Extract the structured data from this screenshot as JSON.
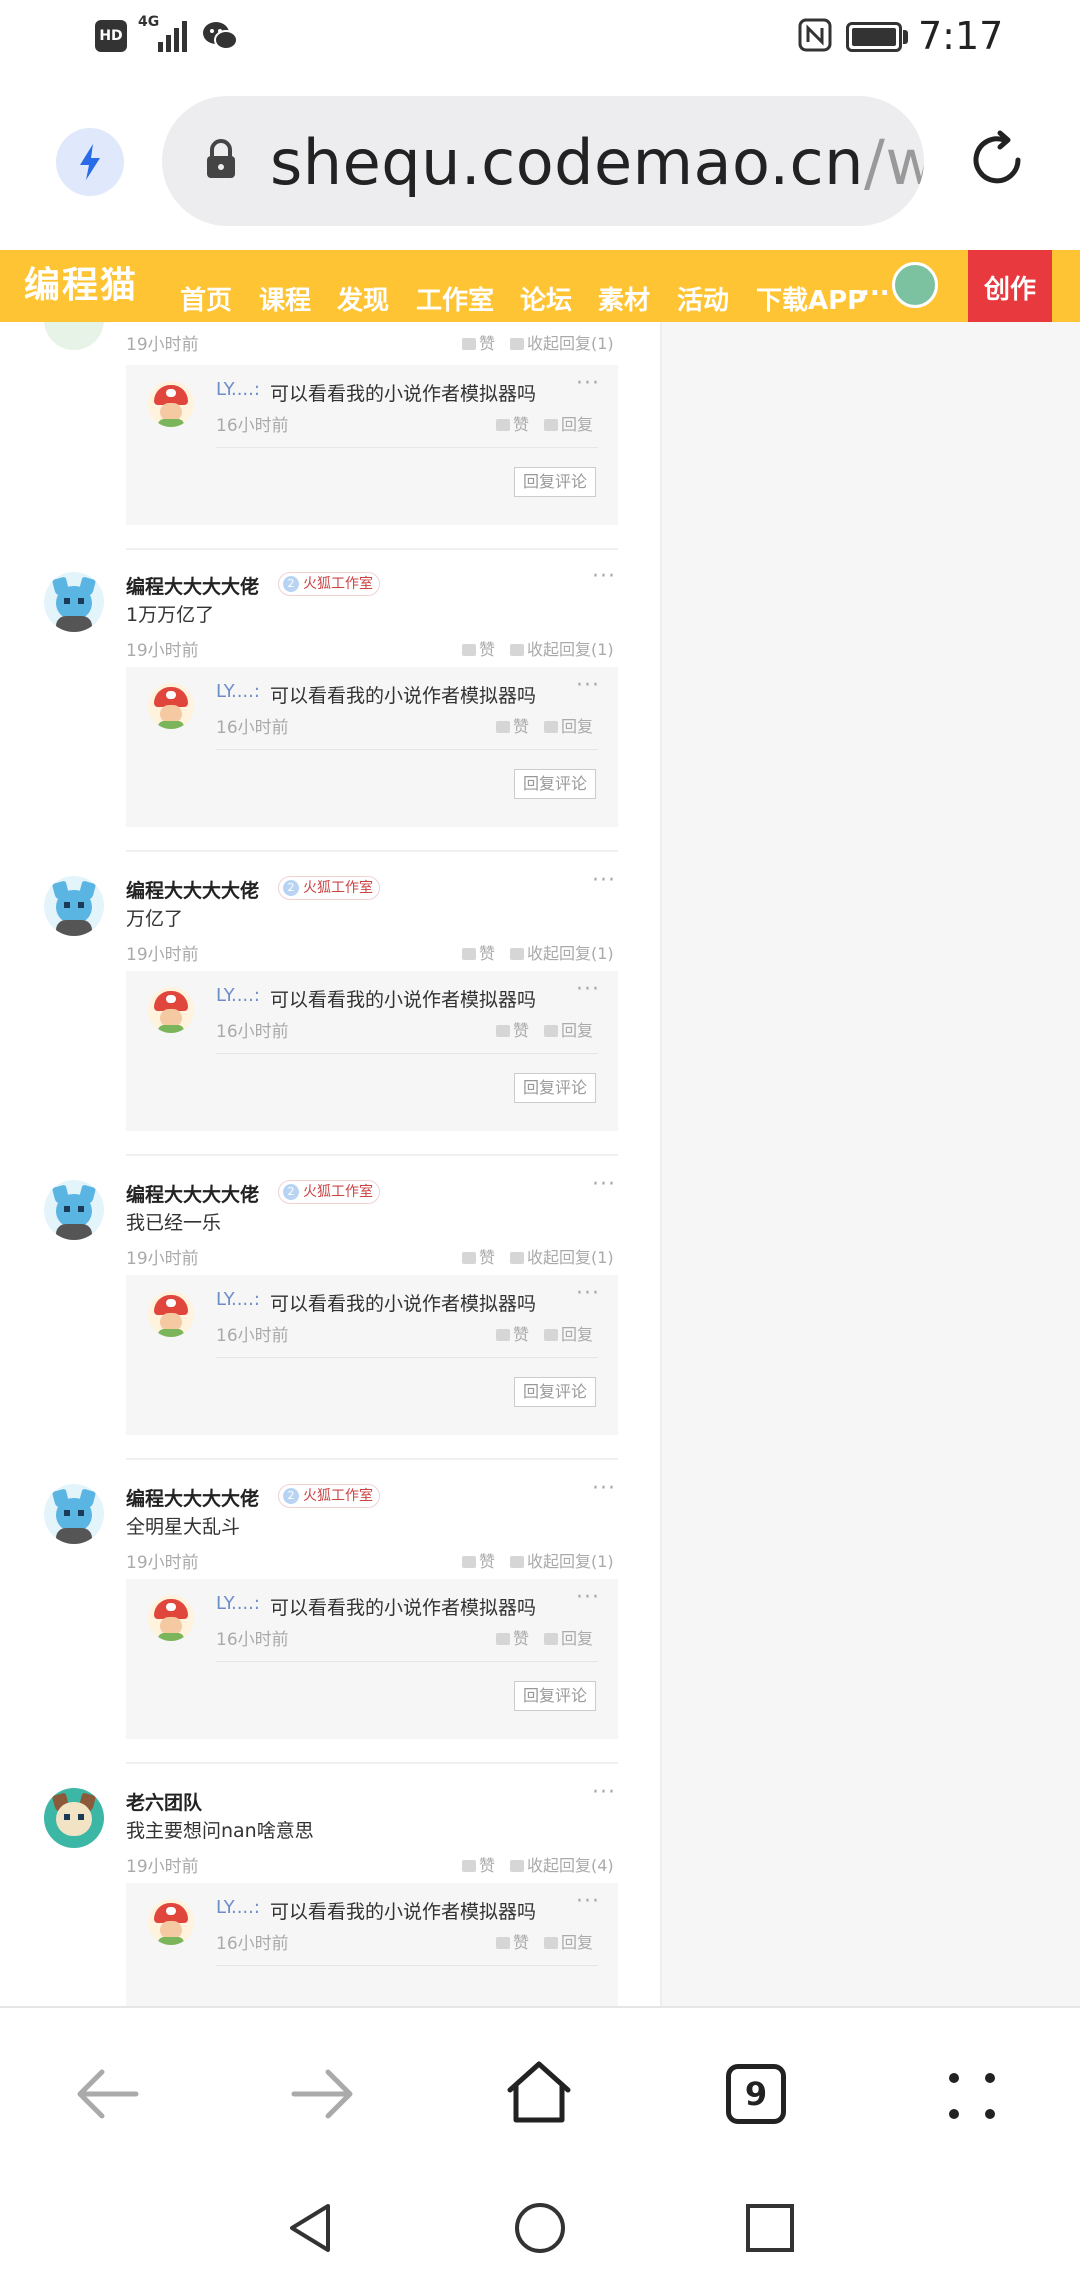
{
  "status_bar": {
    "hd": "HD",
    "signal": "4G",
    "time": "7:17"
  },
  "url_bar": {
    "host": "shequ.codemao.cn",
    "path": "/wo"
  },
  "site_nav": {
    "logo": "编程猫",
    "items": [
      "首页",
      "课程",
      "发现",
      "工作室",
      "论坛",
      "素材",
      "活动",
      "下载APP"
    ],
    "more": "...",
    "create_label": "创作"
  },
  "top_partial": {
    "time": "19小时前",
    "like": "赞",
    "collapse": "收起回复(1)",
    "reply": {
      "name": "LY....:",
      "text": "可以看看我的小说作者模拟器吗",
      "time": "16小时前",
      "like": "赞",
      "reply": "回复",
      "reply_comment": "回复评论"
    }
  },
  "comments": [
    {
      "author": "编程大大大大佬",
      "badge_level": "2",
      "badge": "火狐工作室",
      "text": "1万万亿了",
      "time": "19小时前",
      "like": "赞",
      "collapse": "收起回复(1)",
      "reply": {
        "name": "LY....:",
        "text": "可以看看我的小说作者模拟器吗",
        "time": "16小时前",
        "like": "赞",
        "reply": "回复",
        "reply_comment": "回复评论"
      }
    },
    {
      "author": "编程大大大大佬",
      "badge_level": "2",
      "badge": "火狐工作室",
      "text": "万亿了",
      "time": "19小时前",
      "like": "赞",
      "collapse": "收起回复(1)",
      "reply": {
        "name": "LY....:",
        "text": "可以看看我的小说作者模拟器吗",
        "time": "16小时前",
        "like": "赞",
        "reply": "回复",
        "reply_comment": "回复评论"
      }
    },
    {
      "author": "编程大大大大佬",
      "badge_level": "2",
      "badge": "火狐工作室",
      "text": "我已经一乐",
      "time": "19小时前",
      "like": "赞",
      "collapse": "收起回复(1)",
      "reply": {
        "name": "LY....:",
        "text": "可以看看我的小说作者模拟器吗",
        "time": "16小时前",
        "like": "赞",
        "reply": "回复",
        "reply_comment": "回复评论"
      }
    },
    {
      "author": "编程大大大大佬",
      "badge_level": "2",
      "badge": "火狐工作室",
      "text": "全明星大乱斗",
      "time": "19小时前",
      "like": "赞",
      "collapse": "收起回复(1)",
      "reply": {
        "name": "LY....:",
        "text": "可以看看我的小说作者模拟器吗",
        "time": "16小时前",
        "like": "赞",
        "reply": "回复",
        "reply_comment": "回复评论"
      }
    },
    {
      "author": "老六团队",
      "text": "我主要想问nan啥意思",
      "time": "19小时前",
      "like": "赞",
      "collapse": "收起回复(4)",
      "reply": {
        "name": "LY....:",
        "text": "可以看看我的小说作者模拟器吗",
        "time": "16小时前",
        "like": "赞",
        "reply": "回复"
      }
    }
  ],
  "toolbar": {
    "tab_count": "9"
  },
  "icons": {
    "flash": "lightning-icon",
    "lock": "lock-icon",
    "reload": "reload-icon",
    "back": "back-arrow-icon",
    "forward": "forward-arrow-icon",
    "home": "home-icon",
    "menu": "menu-dots-icon"
  },
  "colors": {
    "brand_yellow": "#fec433",
    "create_red": "#e8393e",
    "link_blue": "#6c8ec7",
    "flash_blue": "#2a6be8"
  }
}
